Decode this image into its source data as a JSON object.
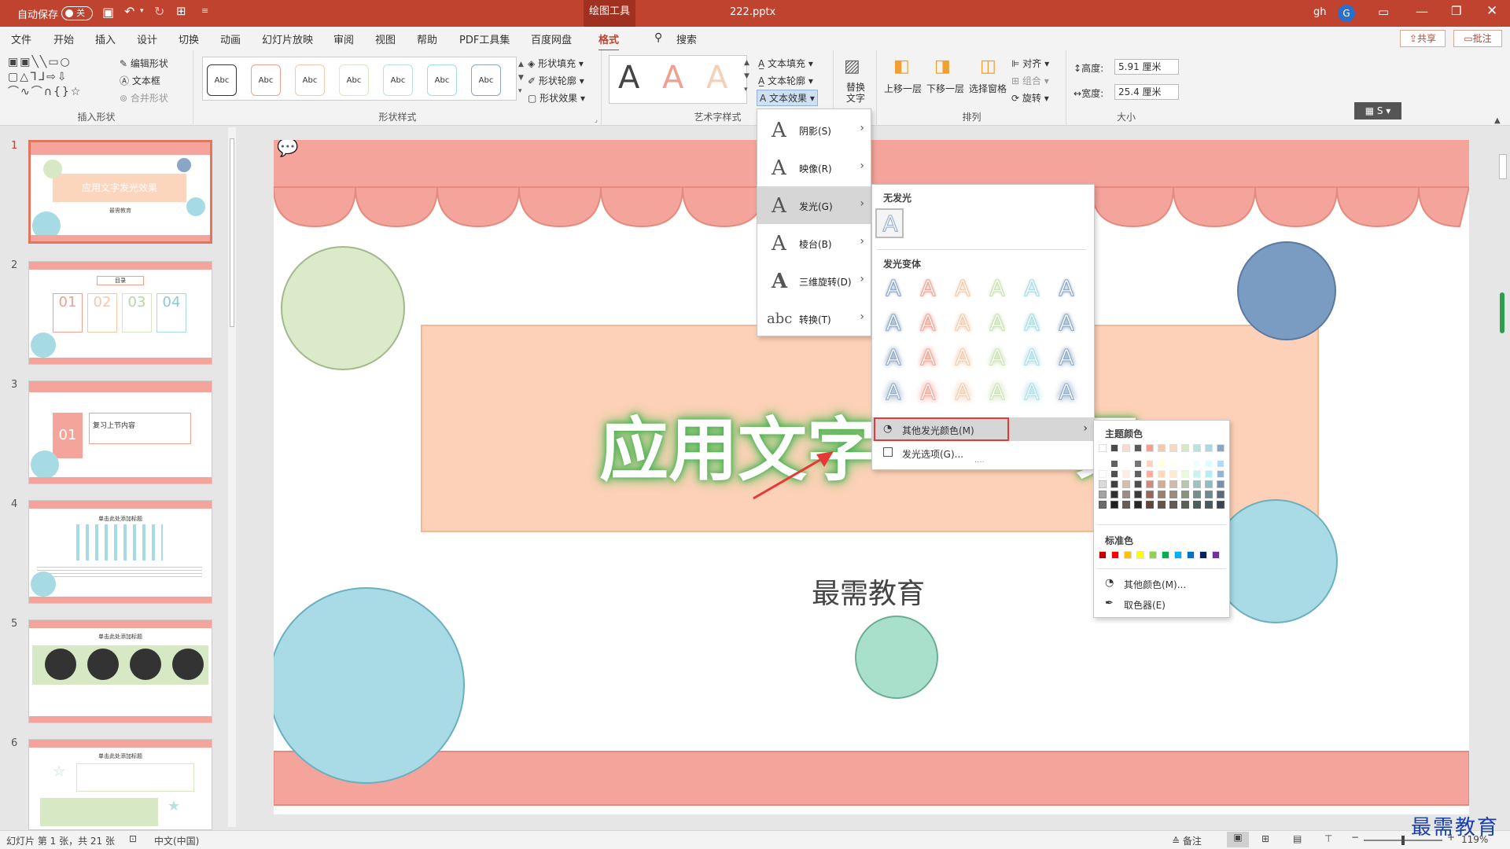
{
  "titlebar": {
    "autosave_label": "自动保存",
    "autosave_state": "关",
    "context_tab": "绘图工具",
    "filename": "222.pptx",
    "user": "gh",
    "avatar_letter": "G"
  },
  "tabs": [
    "文件",
    "开始",
    "插入",
    "设计",
    "切换",
    "动画",
    "幻灯片放映",
    "审阅",
    "视图",
    "帮助",
    "PDF工具集",
    "百度网盘",
    "格式"
  ],
  "search_label": "搜索",
  "share_label": "共享",
  "comment_label": "批注",
  "ribbon": {
    "insert_shapes": {
      "label": "插入形状",
      "edit_shape": "编辑形状",
      "textbox": "文本框",
      "merge_shapes": "合并形状"
    },
    "shape_styles": {
      "label": "形状样式",
      "sample": "Abc",
      "fill": "形状填充",
      "outline": "形状轮廓",
      "effects": "形状效果"
    },
    "wordart": {
      "label": "艺术字样式",
      "sample": "A",
      "text_fill": "文本填充",
      "text_outline": "文本轮廓",
      "text_effects": "文本效果"
    },
    "alt_text": "替换文字",
    "arrange": {
      "label": "排列",
      "bring_forward": "上移一层",
      "send_backward": "下移一层",
      "selection_pane": "选择窗格",
      "align": "对齐",
      "group": "组合",
      "rotate": "旋转"
    },
    "size": {
      "label": "大小",
      "height_label": "高度:",
      "height_value": "5.91 厘米",
      "width_label": "宽度:",
      "width_value": "25.4 厘米"
    }
  },
  "text_effects_menu": [
    {
      "icon": "A",
      "label": "阴影(S)"
    },
    {
      "icon": "A",
      "label": "映像(R)"
    },
    {
      "icon": "A",
      "label": "发光(G)"
    },
    {
      "icon": "A",
      "label": "棱台(B)"
    },
    {
      "icon": "A",
      "label": "三维旋转(D)"
    },
    {
      "icon": "abc",
      "label": "转换(T)"
    }
  ],
  "glow_menu": {
    "no_glow": "无发光",
    "variants": "发光变体",
    "more_colors": "其他发光颜色(M)",
    "options": "发光选项(G)..."
  },
  "color_menu": {
    "theme_colors": "主题颜色",
    "standard_colors": "标准色",
    "more_colors": "其他颜色(M)...",
    "eyedropper": "取色器(E)",
    "theme_row": [
      "#ffffff",
      "#4a4a4a",
      "#f6dcd0",
      "#5a5a5a",
      "#f0a090",
      "#f4c8a8",
      "#f6d9c0",
      "#d6e8c4",
      "#b8e2dc",
      "#a6dbe4",
      "#8aa6c4"
    ],
    "standard_row": [
      "#c00000",
      "#ff0000",
      "#ffc000",
      "#ffff00",
      "#92d050",
      "#00b050",
      "#00b0f0",
      "#0070c0",
      "#002060",
      "#7030a0"
    ]
  },
  "slides": [
    {
      "num": "1",
      "title": "应用文字发光效果",
      "subtitle": "最需教育"
    },
    {
      "num": "2",
      "title": "目录",
      "items": [
        "01",
        "02",
        "03",
        "04"
      ]
    },
    {
      "num": "3",
      "title": "复习上节内容",
      "item": "01"
    },
    {
      "num": "4",
      "title": "单击此处添加标题"
    },
    {
      "num": "5",
      "title": "单击此处添加标题"
    },
    {
      "num": "6",
      "title": "单击此处添加标题"
    }
  ],
  "main_slide": {
    "title": "应用文字",
    "title_tail": "果",
    "subtitle": "最需教育"
  },
  "status": {
    "slide_info": "幻灯片 第 1 张，共 21 张",
    "language": "中文(中国)",
    "notes": "备注",
    "zoom": "119%",
    "watermark": "最需教育"
  },
  "colors": {
    "accent": "#c0432f",
    "green_glow": "#4caf50",
    "highlight": "#e53935"
  }
}
